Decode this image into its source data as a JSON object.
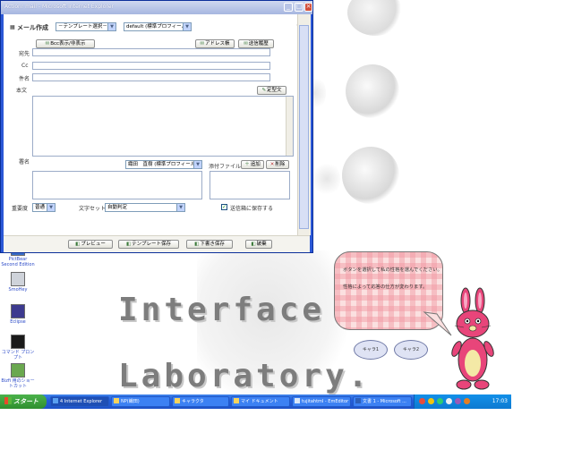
{
  "window": {
    "title": "Action! mail - Microsoft Internet Explorer",
    "minimize_glyph": "_",
    "maximize_glyph": "□",
    "close_glyph": "×"
  },
  "form": {
    "heading": "メール作成",
    "template_select": "－テンプレート選択－",
    "profile_select": "default (標準プロフィール)",
    "bcc_button": "Bcc表示/非表示",
    "address_book_button": "アドレス帳",
    "send_history_button": "送信履歴",
    "to_label": "宛先",
    "cc_label": "Cc",
    "subject_label": "件名",
    "body_label": "本文",
    "fixed_phrase_button": "定型文",
    "signature_label": "署名",
    "signature_select": "織田　直樹 (標準プロフィール)",
    "attachment_label": "添付ファイル",
    "add_button": "追加",
    "delete_button": "削除",
    "importance_label": "重要度",
    "importance_value": "普通",
    "charset_label": "文字セット",
    "charset_value": "自動判定",
    "save_to_sent_label": "送信箱に保存する",
    "save_to_sent_checked": true
  },
  "footer": {
    "preview_button": "プレビュー",
    "template_save_button": "テンプレート保存",
    "draft_save_button": "下書き保存",
    "close_button": "破棄"
  },
  "desktop": {
    "background_word_1": "Interface",
    "background_word_2": "Laboratory.",
    "icons": [
      {
        "label": "PictBear Second Edition",
        "color": "#3b6fc8"
      },
      {
        "label": "SmoHey",
        "color": "#cfd3da"
      },
      {
        "label": "Eclipse",
        "color": "#3d3a8f"
      },
      {
        "label": "コマンド プロンプト",
        "color": "#1a1a1a"
      },
      {
        "label": "Bizfi 用のショートカット",
        "color": "#6aa84f"
      }
    ]
  },
  "taskbar": {
    "start_label": "スタート",
    "items": [
      {
        "label": "4 Internet Explorer",
        "active": true
      },
      {
        "label": "NP(織田)",
        "active": false
      },
      {
        "label": "キャラクタ",
        "active": false
      },
      {
        "label": "マイ ドキュメント",
        "active": false
      },
      {
        "label": "tujitahtml - EmEditor",
        "active": false
      },
      {
        "label": "文書 1 - Microsoft ...",
        "active": false
      }
    ],
    "clock": "17:03"
  },
  "character": {
    "bubble_line_1": "ボタンを選択して私の性格を選んでください。",
    "bubble_line_2": "性格によって応答の仕方が変わります。",
    "button_1": "キャラ1",
    "button_2": "キャラ2",
    "body_color": "#e8457a"
  }
}
